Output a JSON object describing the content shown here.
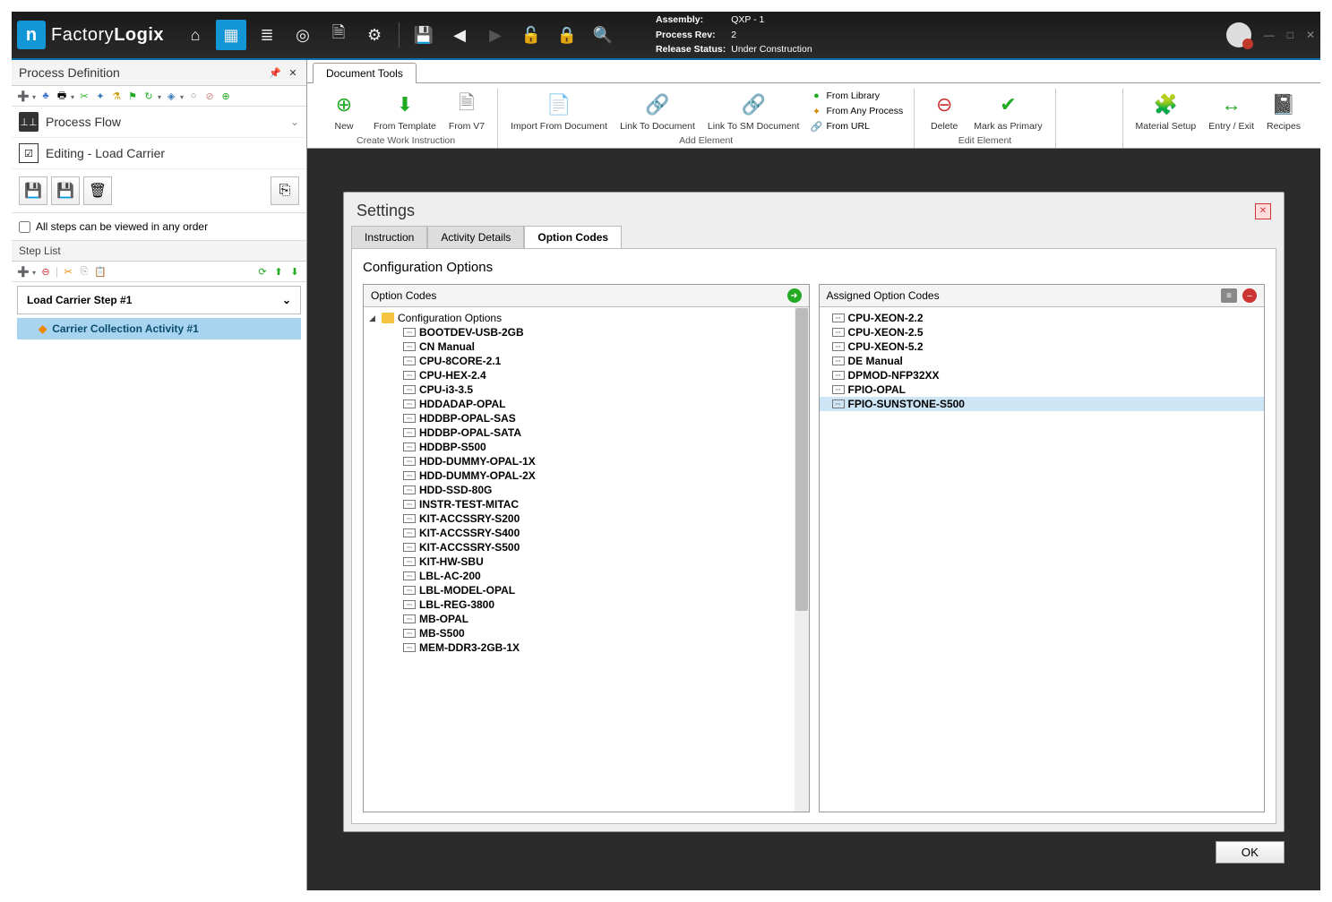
{
  "titlebar": {
    "brand_a": "Factory",
    "brand_b": "Logix",
    "assembly_label": "Assembly:",
    "assembly_value": "QXP - 1",
    "rev_label": "Process Rev:",
    "rev_value": "2",
    "status_label": "Release Status:",
    "status_value": "Under Construction"
  },
  "sidebar": {
    "title": "Process Definition",
    "process_flow": "Process Flow",
    "editing": "Editing - Load Carrier",
    "checkbox_label": "All steps can be viewed in any order",
    "step_list": "Step List",
    "step1": "Load Carrier Step #1",
    "activity1": "Carrier Collection Activity #1"
  },
  "ribbon": {
    "tab": "Document Tools",
    "new": "New",
    "from_template": "From\nTemplate",
    "from_v7": "From\nV7",
    "group1": "Create Work Instruction",
    "import_from_doc": "Import From\nDocument",
    "link_to_doc": "Link To\nDocument",
    "link_to_sm_doc": "Link To SM\nDocument",
    "from_library": "From Library",
    "from_any_process": "From Any Process",
    "from_url": "From URL",
    "group2": "Add Element",
    "delete": "Delete",
    "mark_primary": "Mark as\nPrimary",
    "group3": "Edit Element",
    "material_setup": "Material\nSetup",
    "entry_exit": "Entry / Exit",
    "recipes": "Recipes"
  },
  "settings": {
    "title": "Settings",
    "tab1": "Instruction",
    "tab2": "Activity Details",
    "tab3": "Option Codes",
    "body_title": "Configuration Options",
    "left_header": "Option Codes",
    "right_header": "Assigned Option Codes",
    "tree_root": "Configuration Options",
    "left_items": [
      "BOOTDEV-USB-2GB",
      "CN Manual",
      "CPU-8CORE-2.1",
      "CPU-HEX-2.4",
      "CPU-i3-3.5",
      "HDDADAP-OPAL",
      "HDDBP-OPAL-SAS",
      "HDDBP-OPAL-SATA",
      "HDDBP-S500",
      "HDD-DUMMY-OPAL-1X",
      "HDD-DUMMY-OPAL-2X",
      "HDD-SSD-80G",
      "INSTR-TEST-MITAC",
      "KIT-ACCSSRY-S200",
      "KIT-ACCSSRY-S400",
      "KIT-ACCSSRY-S500",
      "KIT-HW-SBU",
      "LBL-AC-200",
      "LBL-MODEL-OPAL",
      "LBL-REG-3800",
      "MB-OPAL",
      "MB-S500",
      "MEM-DDR3-2GB-1X"
    ],
    "right_items": [
      "CPU-XEON-2.2",
      "CPU-XEON-2.5",
      "CPU-XEON-5.2",
      "DE Manual",
      "DPMOD-NFP32XX",
      "FPIO-OPAL",
      "FPIO-SUNSTONE-S500"
    ],
    "ok": "OK"
  }
}
